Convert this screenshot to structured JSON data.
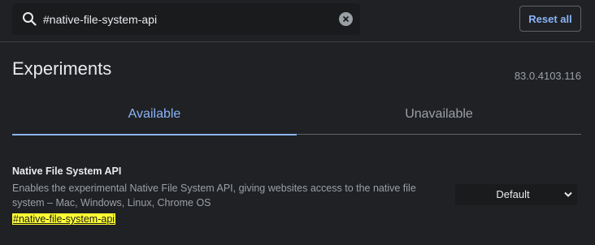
{
  "search": {
    "value": "#native-file-system-api",
    "icon": "search-icon",
    "clear_icon": "clear-icon"
  },
  "header": {
    "reset_label": "Reset all",
    "title": "Experiments",
    "version": "83.0.4103.116"
  },
  "tabs": [
    {
      "label": "Available",
      "active": true
    },
    {
      "label": "Unavailable",
      "active": false
    }
  ],
  "experiments": [
    {
      "title": "Native File System API",
      "description": "Enables the experimental Native File System API, giving websites access to the native file system – Mac, Windows, Linux, Chrome OS",
      "link": "#native-file-system-api",
      "selected": "Default"
    }
  ],
  "colors": {
    "background": "#202124",
    "accent": "#8ab4f8",
    "highlight": "#ffff33",
    "secondary_text": "#9aa0a6"
  }
}
